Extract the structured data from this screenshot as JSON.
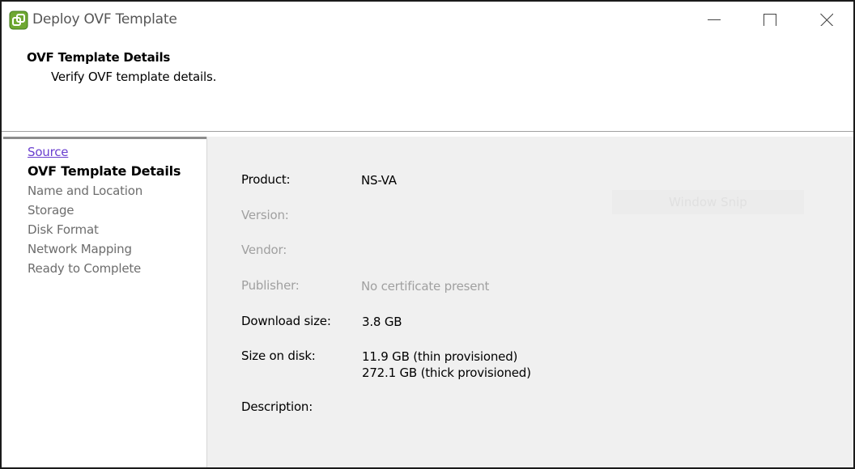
{
  "window": {
    "title": "Deploy OVF Template",
    "icon": "vsphere-app-icon"
  },
  "header": {
    "title": "OVF Template Details",
    "subtitle": "Verify OVF template details."
  },
  "nav": {
    "items": [
      {
        "label": "Source",
        "state": "link"
      },
      {
        "label": "OVF Template Details",
        "state": "current"
      },
      {
        "label": "Name and Location",
        "state": "inactive"
      },
      {
        "label": "Storage",
        "state": "inactive"
      },
      {
        "label": "Disk Format",
        "state": "inactive"
      },
      {
        "label": "Network Mapping",
        "state": "inactive"
      },
      {
        "label": "Ready to Complete",
        "state": "inactive"
      }
    ]
  },
  "details": {
    "product_label": "Product:",
    "product_value": "NS-VA",
    "version_label": "Version:",
    "vendor_label": "Vendor:",
    "publisher_label": "Publisher:",
    "publisher_value": "No certificate present",
    "download_label": "Download size:",
    "download_value": "3.8 GB",
    "disk_label": "Size on disk:",
    "disk_thin": "11.9 GB (thin provisioned)",
    "disk_thick": "272.1 GB (thick provisioned)",
    "description_label": "Description:"
  },
  "overlay": {
    "ghost_text": "Window Snip"
  },
  "colors": {
    "link": "#6a3fcf",
    "inactive": "#6d6d6d",
    "disabled": "#a0a0a0",
    "panel": "#f0f0f0"
  }
}
